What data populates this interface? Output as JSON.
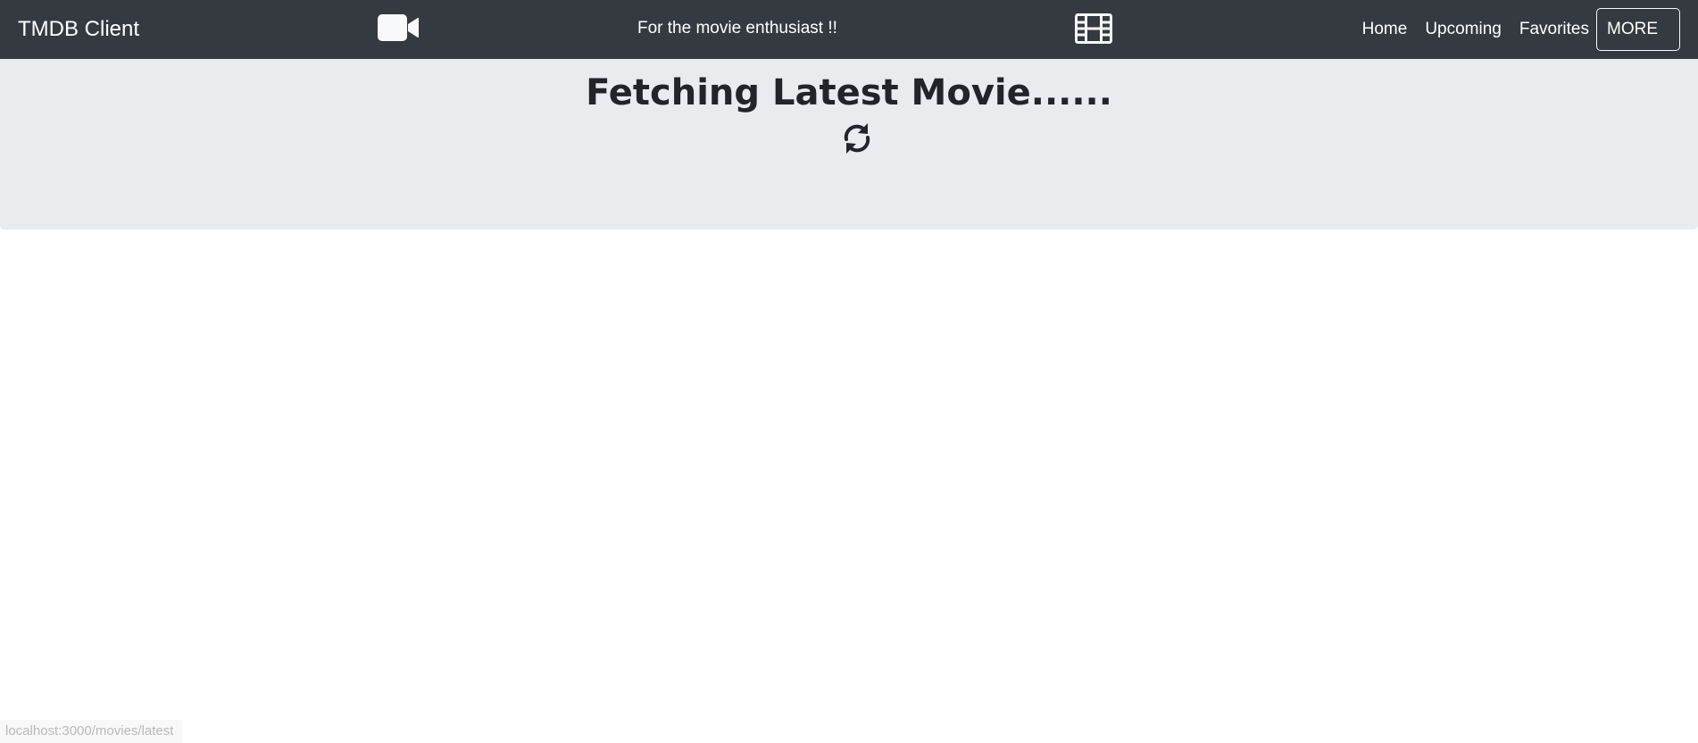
{
  "navbar": {
    "brand": "TMDB Client",
    "camera_icon": "video-camera-icon",
    "tagline": "For the movie enthusiast !!",
    "film_icon": "film-icon",
    "links": [
      {
        "label": "Home"
      },
      {
        "label": "Upcoming"
      },
      {
        "label": "Favorites"
      }
    ],
    "more_button": "MORE"
  },
  "main": {
    "heading": "Fetching Latest Movie......",
    "loading_icon": "refresh-icon"
  },
  "status_bar": {
    "url": "localhost:3000/movies/latest"
  },
  "colors": {
    "navbar_bg": "#343a40",
    "jumbotron_bg": "#e9ecef",
    "heading_text": "#212529"
  }
}
